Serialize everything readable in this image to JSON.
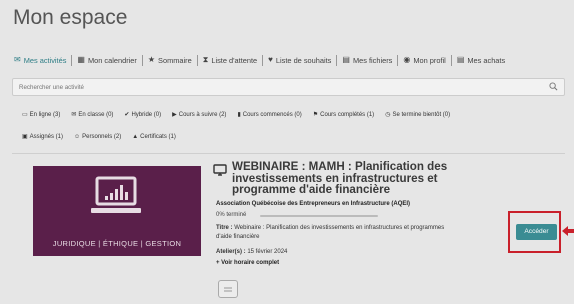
{
  "page": {
    "title": "Mon espace"
  },
  "nav": {
    "items": [
      {
        "label": "Mes activités",
        "icon": "chat-bubbles-icon",
        "active": true
      },
      {
        "label": "Mon calendrier",
        "icon": "calendar-icon"
      },
      {
        "label": "Sommaire",
        "icon": "trophy-icon"
      },
      {
        "label": "Liste d'attente",
        "icon": "hourglass-icon"
      },
      {
        "label": "Liste de souhaits",
        "icon": "heart-icon"
      },
      {
        "label": "Mes fichiers",
        "icon": "file-icon"
      },
      {
        "label": "Mon profil",
        "icon": "user-circle-icon"
      },
      {
        "label": "Mes achats",
        "icon": "receipt-icon"
      }
    ]
  },
  "search": {
    "placeholder": "Rechercher une activité"
  },
  "filters": {
    "row1": [
      {
        "label": "En ligne (3)",
        "icon": "monitor-icon"
      },
      {
        "label": "En classe (0)",
        "icon": "chat-bubbles-icon"
      },
      {
        "label": "Hybride (0)",
        "icon": "check-circle-icon"
      },
      {
        "label": "Cours à suivre (2)",
        "icon": "play-circle-icon"
      },
      {
        "label": "Cours commencés (0)",
        "icon": "bookmark-icon"
      },
      {
        "label": "Cours complétés (1)",
        "icon": "flag-icon"
      },
      {
        "label": "Se termine bientôt (0)",
        "icon": "clock-icon"
      }
    ],
    "row2": [
      {
        "label": "Assignés (1)",
        "icon": "id-card-icon"
      },
      {
        "label": "Personnels (2)",
        "icon": "user-icon"
      },
      {
        "label": "Certificats (1)",
        "icon": "graduation-cap-icon"
      }
    ]
  },
  "course": {
    "thumbnail_label": "JURIDIQUE | ÉTHIQUE | GESTION",
    "title": "WEBINAIRE : MAMH : Planification des investissements en infrastructures et programme d'aide financière",
    "organization": "Association Québécoise des Entrepreneurs en Infrastructure (AQEI)",
    "progress_text": "0% terminé",
    "progress": 0,
    "title_label": "Titre :",
    "title_value": "Webinaire : Planification des investissements en infrastructures et programmes d'aide financière",
    "atelier_label": "Atelier(s) :",
    "atelier_value": "15 février 2024",
    "schedule_link": "+ Voir horaire complet",
    "access_button": "Accéder"
  },
  "colors": {
    "accent": "#3a8c93",
    "highlight": "#c9202b",
    "thumbnail_bg": "#5a1f4a"
  }
}
